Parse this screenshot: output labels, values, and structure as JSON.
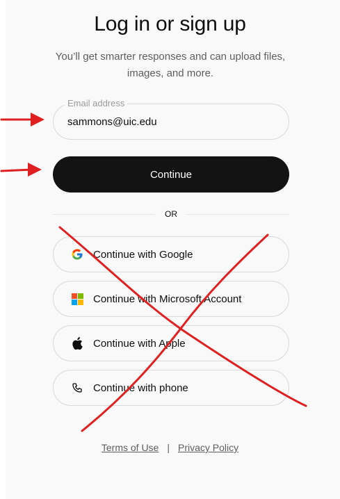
{
  "page": {
    "title": "Log in or sign up",
    "subtitle": "You’ll get smarter responses and can upload files, images, and more."
  },
  "email": {
    "label": "Email address",
    "value": "sammons@uic.edu"
  },
  "continue_label": "Continue",
  "divider_label": "OR",
  "social": [
    {
      "label": "Continue with Google",
      "icon": "google-icon"
    },
    {
      "label": "Continue with Microsoft Account",
      "icon": "microsoft-icon"
    },
    {
      "label": "Continue with Apple",
      "icon": "apple-icon"
    },
    {
      "label": "Continue with phone",
      "icon": "phone-icon"
    }
  ],
  "footer": {
    "terms": "Terms of Use",
    "separator": "|",
    "privacy": "Privacy Policy"
  },
  "annotation_colors": {
    "red": "#e02020"
  }
}
